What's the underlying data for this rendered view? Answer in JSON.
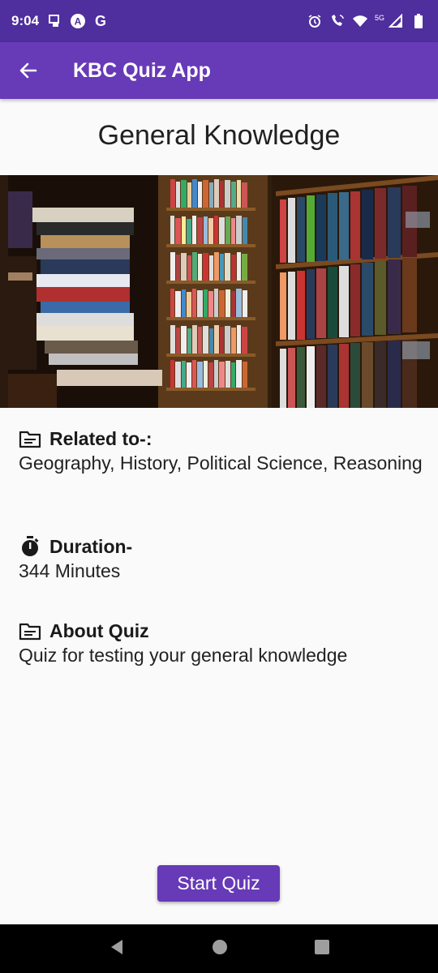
{
  "status_bar": {
    "time": "9:04",
    "network": "5G"
  },
  "app_bar": {
    "title": "KBC Quiz App"
  },
  "page": {
    "title": "General Knowledge"
  },
  "sections": {
    "related": {
      "heading": "Related to-:",
      "body": "Geography, History, Political Science, Reasoning"
    },
    "duration": {
      "heading": "Duration-",
      "body": "344 Minutes"
    },
    "about": {
      "heading": "About Quiz",
      "body": "Quiz for testing your general knowledge"
    }
  },
  "start_button": {
    "label": "Start Quiz"
  },
  "colors": {
    "status_bar": "#4f2e9e",
    "app_bar": "#673ab7",
    "button": "#673ab7"
  }
}
